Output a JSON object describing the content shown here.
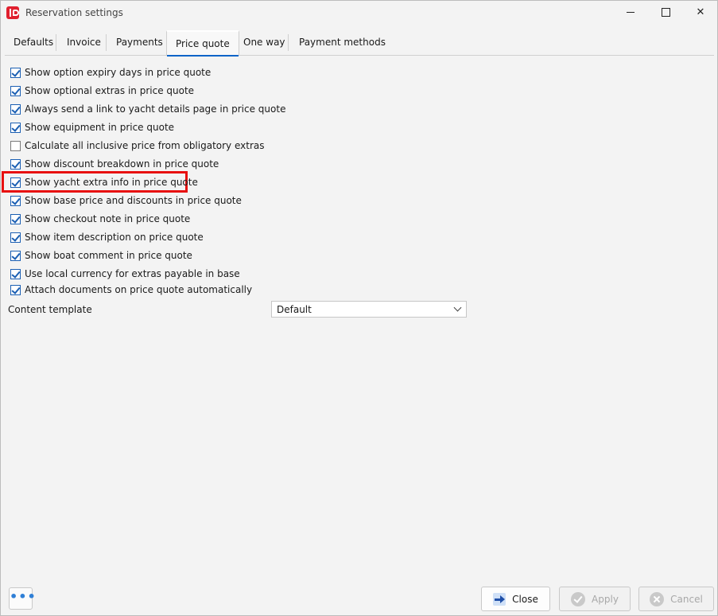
{
  "window": {
    "title": "Reservation settings"
  },
  "tabs": [
    {
      "label": "Defaults",
      "active": false
    },
    {
      "label": "Invoice",
      "active": false
    },
    {
      "label": "Payments",
      "active": false
    },
    {
      "label": "Price quote",
      "active": true
    },
    {
      "label": "One way",
      "active": false
    },
    {
      "label": "Payment methods",
      "active": false
    }
  ],
  "options": [
    {
      "label": "Show option expiry days in price quote",
      "checked": true
    },
    {
      "label": "Show optional extras in price quote",
      "checked": true
    },
    {
      "label": "Always send a link to yacht details page in price quote",
      "checked": true
    },
    {
      "label": "Show equipment in price quote",
      "checked": true
    },
    {
      "label": "Calculate all inclusive price from obligatory extras",
      "checked": false
    },
    {
      "label": "Show discount breakdown in price quote",
      "checked": true
    },
    {
      "label": "Show yacht extra info in price quote",
      "checked": true,
      "highlighted": true
    },
    {
      "label": "Show base price and discounts in price quote",
      "checked": true
    },
    {
      "label": "Show checkout note in price quote",
      "checked": true
    },
    {
      "label": "Show item description on price quote",
      "checked": true
    },
    {
      "label": "Show boat comment in price quote",
      "checked": true
    },
    {
      "label": "Use local currency for extras payable in base",
      "checked": true
    },
    {
      "label": "Attach documents on price quote automatically",
      "checked": true
    }
  ],
  "content_template": {
    "label": "Content template",
    "value": "Default"
  },
  "footer": {
    "more_label": "•••",
    "close_label": "Close",
    "apply_label": "Apply",
    "cancel_label": "Cancel"
  },
  "colors": {
    "accent": "#0a64c8",
    "highlight": "#e81010",
    "brand": "#e0202e"
  }
}
